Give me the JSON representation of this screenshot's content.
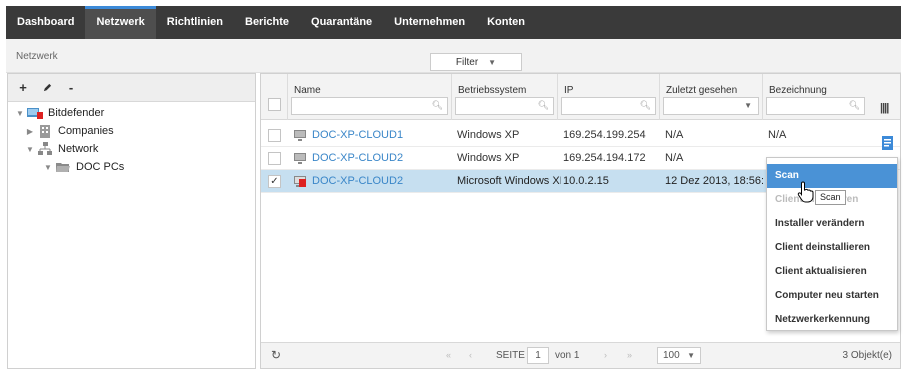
{
  "nav": {
    "tabs": [
      {
        "label": "Dashboard",
        "active": false
      },
      {
        "label": "Netzwerk",
        "active": true
      },
      {
        "label": "Richtlinien",
        "active": false
      },
      {
        "label": "Berichte",
        "active": false
      },
      {
        "label": "Quarantäne",
        "active": false
      },
      {
        "label": "Unternehmen",
        "active": false
      },
      {
        "label": "Konten",
        "active": false
      }
    ]
  },
  "breadcrumb": "Netzwerk",
  "filter_label": "Filter",
  "tree_toolbar": {
    "add": "+",
    "edit": "✎",
    "remove": "-"
  },
  "tree": {
    "root": "Bitdefender",
    "companies": "Companies",
    "network": "Network",
    "doc_pcs": "DOC PCs"
  },
  "grid": {
    "columns": {
      "name": "Name",
      "os": "Betriebssystem",
      "ip": "IP",
      "last_seen": "Zuletzt gesehen",
      "label": "Bezeichnung"
    },
    "rows": [
      {
        "name": "DOC-XP-CLOUD1",
        "os": "Windows XP",
        "ip": "169.254.199.254",
        "last_seen": "N/A",
        "label": "N/A",
        "checked": false
      },
      {
        "name": "DOC-XP-CLOUD2",
        "os": "Windows XP",
        "ip": "169.254.194.172",
        "last_seen": "N/A",
        "label": "",
        "checked": false
      },
      {
        "name": "DOC-XP-CLOUD2",
        "os": "Microsoft Windows XP",
        "ip": "10.0.2.15",
        "last_seen": "12 Dez 2013, 18:56:...",
        "label": "",
        "checked": true
      }
    ]
  },
  "pager": {
    "seite": "SEITE",
    "page": "1",
    "von": "von 1",
    "per_page": "100",
    "count": "3 Objekt(e)",
    "first": "«",
    "prev": "‹",
    "next": "›",
    "last": "»"
  },
  "context_menu": {
    "items": [
      {
        "label": "Scan",
        "highlighted": true,
        "disabled": false
      },
      {
        "label": "Client installieren",
        "highlighted": false,
        "disabled": true
      },
      {
        "label": "Installer verändern",
        "highlighted": false,
        "disabled": false
      },
      {
        "label": "Client deinstallieren",
        "highlighted": false,
        "disabled": false
      },
      {
        "label": "Client aktualisieren",
        "highlighted": false,
        "disabled": false
      },
      {
        "label": "Computer neu starten",
        "highlighted": false,
        "disabled": false
      },
      {
        "label": "Netzwerkerkennung",
        "highlighted": false,
        "disabled": false
      }
    ]
  },
  "tooltip": "Scan",
  "colors": {
    "nav_bg": "#3a3a3a",
    "accent": "#3c8ad8",
    "selected_row": "#c6dff0",
    "menu_highlight": "#4a92d6",
    "link": "#3a86c8"
  }
}
